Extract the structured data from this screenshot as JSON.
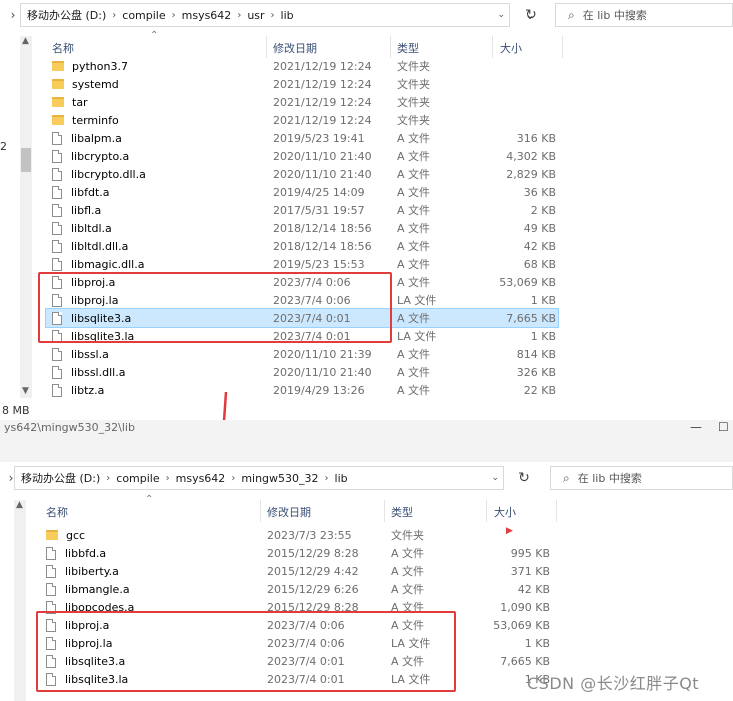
{
  "win1": {
    "breadcrumb": [
      "移动办公盘 (D:)",
      "compile",
      "msys642",
      "usr",
      "lib"
    ],
    "search_placeholder": "在 lib 中搜索",
    "headers": {
      "name": "名称",
      "date": "修改日期",
      "type": "类型",
      "size": "大小"
    },
    "left_edge_digit": "2",
    "status_size": "8 MB",
    "rows": [
      {
        "kind": "folder",
        "name": "python3.7",
        "date": "2021/12/19 12:24",
        "type": "文件夹",
        "size": ""
      },
      {
        "kind": "folder",
        "name": "systemd",
        "date": "2021/12/19 12:24",
        "type": "文件夹",
        "size": ""
      },
      {
        "kind": "folder",
        "name": "tar",
        "date": "2021/12/19 12:24",
        "type": "文件夹",
        "size": ""
      },
      {
        "kind": "folder",
        "name": "terminfo",
        "date": "2021/12/19 12:24",
        "type": "文件夹",
        "size": ""
      },
      {
        "kind": "file",
        "name": "libalpm.a",
        "date": "2019/5/23 19:41",
        "type": "A 文件",
        "size": "316 KB"
      },
      {
        "kind": "file",
        "name": "libcrypto.a",
        "date": "2020/11/10 21:40",
        "type": "A 文件",
        "size": "4,302 KB"
      },
      {
        "kind": "file",
        "name": "libcrypto.dll.a",
        "date": "2020/11/10 21:40",
        "type": "A 文件",
        "size": "2,829 KB"
      },
      {
        "kind": "file",
        "name": "libfdt.a",
        "date": "2019/4/25 14:09",
        "type": "A 文件",
        "size": "36 KB"
      },
      {
        "kind": "file",
        "name": "libfl.a",
        "date": "2017/5/31 19:57",
        "type": "A 文件",
        "size": "2 KB"
      },
      {
        "kind": "file",
        "name": "libltdl.a",
        "date": "2018/12/14 18:56",
        "type": "A 文件",
        "size": "49 KB"
      },
      {
        "kind": "file",
        "name": "libltdl.dll.a",
        "date": "2018/12/14 18:56",
        "type": "A 文件",
        "size": "42 KB"
      },
      {
        "kind": "file",
        "name": "libmagic.dll.a",
        "date": "2019/5/23 15:53",
        "type": "A 文件",
        "size": "68 KB"
      },
      {
        "kind": "file",
        "name": "libproj.a",
        "date": "2023/7/4 0:06",
        "type": "A 文件",
        "size": "53,069 KB"
      },
      {
        "kind": "file",
        "name": "libproj.la",
        "date": "2023/7/4 0:06",
        "type": "LA 文件",
        "size": "1 KB"
      },
      {
        "kind": "file",
        "name": "libsqlite3.a",
        "date": "2023/7/4 0:01",
        "type": "A 文件",
        "size": "7,665 KB",
        "selected": true
      },
      {
        "kind": "file",
        "name": "libsqlite3.la",
        "date": "2023/7/4 0:01",
        "type": "LA 文件",
        "size": "1 KB"
      },
      {
        "kind": "file",
        "name": "libssl.a",
        "date": "2020/11/10 21:39",
        "type": "A 文件",
        "size": "814 KB"
      },
      {
        "kind": "file",
        "name": "libssl.dll.a",
        "date": "2020/11/10 21:40",
        "type": "A 文件",
        "size": "326 KB"
      },
      {
        "kind": "file",
        "name": "libtz.a",
        "date": "2019/4/29 13:26",
        "type": "A 文件",
        "size": "22 KB"
      }
    ]
  },
  "win2": {
    "title_path": "ys642\\mingw530_32\\lib",
    "breadcrumb": [
      "移动办公盘 (D:)",
      "compile",
      "msys642",
      "mingw530_32",
      "lib"
    ],
    "search_placeholder": "在 lib 中搜索",
    "headers": {
      "name": "名称",
      "date": "修改日期",
      "type": "类型",
      "size": "大小"
    },
    "rows": [
      {
        "kind": "folder",
        "name": "gcc",
        "date": "2023/7/3 23:55",
        "type": "文件夹",
        "size": ""
      },
      {
        "kind": "file",
        "name": "libbfd.a",
        "date": "2015/12/29 8:28",
        "type": "A 文件",
        "size": "995 KB"
      },
      {
        "kind": "file",
        "name": "libiberty.a",
        "date": "2015/12/29 4:42",
        "type": "A 文件",
        "size": "371 KB"
      },
      {
        "kind": "file",
        "name": "libmangle.a",
        "date": "2015/12/29 6:26",
        "type": "A 文件",
        "size": "42 KB"
      },
      {
        "kind": "file",
        "name": "libopcodes.a",
        "date": "2015/12/29 8:28",
        "type": "A 文件",
        "size": "1,090 KB"
      },
      {
        "kind": "file",
        "name": "libproj.a",
        "date": "2023/7/4 0:06",
        "type": "A 文件",
        "size": "53,069 KB"
      },
      {
        "kind": "file",
        "name": "libproj.la",
        "date": "2023/7/4 0:06",
        "type": "LA 文件",
        "size": "1 KB"
      },
      {
        "kind": "file",
        "name": "libsqlite3.a",
        "date": "2023/7/4 0:01",
        "type": "A 文件",
        "size": "7,665 KB"
      },
      {
        "kind": "file",
        "name": "libsqlite3.la",
        "date": "2023/7/4 0:01",
        "type": "LA 文件",
        "size": "1 KB"
      }
    ]
  },
  "watermark": "CSDN @长沙红胖子Qt",
  "colors": {
    "highlight_box": "#e23b3b",
    "selection": "#cce8ff",
    "header_text": "#3a5074"
  }
}
